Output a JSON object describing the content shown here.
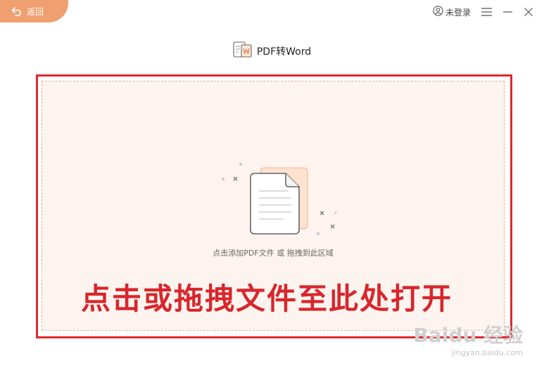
{
  "header": {
    "back_label": "返回",
    "login_label": "未登录",
    "app_title": "PDF转Word"
  },
  "drop_zone": {
    "hint": "点击添加PDF文件 或 拖拽到此区域",
    "annotation": "点击或拖拽文件至此处打开"
  },
  "watermark": {
    "brand": "Baidu 经验",
    "url": "jingyan.baidu.com"
  },
  "colors": {
    "accent": "#f0a070",
    "annotation_red": "#d8262c",
    "drop_bg": "#fdf4ef"
  }
}
